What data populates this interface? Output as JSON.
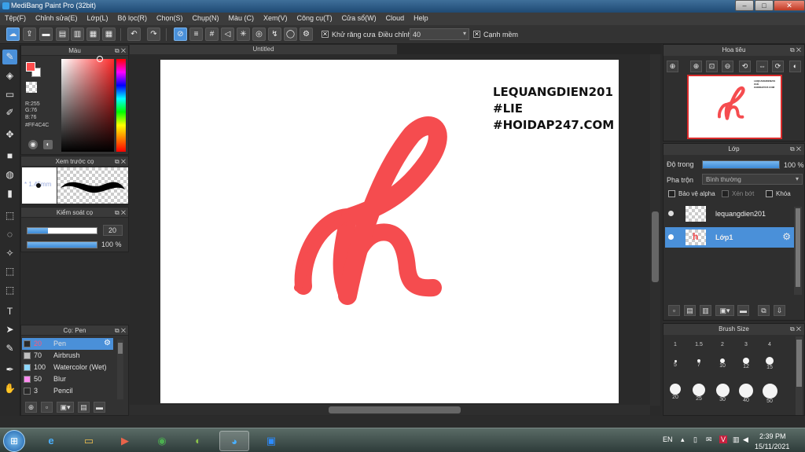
{
  "window": {
    "title": "MediBang Paint Pro (32bit)",
    "minimize": "–",
    "maximize": "□",
    "close": "✕"
  },
  "menu": [
    "Tệp(F)",
    "Chỉnh sửa(E)",
    "Lớp(L)",
    "Bộ lọc(R)",
    "Chọn(S)",
    "Chụp(N)",
    "Màu (C)",
    "Xem(V)",
    "Công cụ(T)",
    "Cửa sổ(W)",
    "Cloud",
    "Help"
  ],
  "toolbar": {
    "antialias_label": "Khử răng cưa",
    "antialias_checked": "✕",
    "adjust_label": "Điều chỉnh",
    "adjust_value": "40",
    "sharp_label": "Cạnh mềm",
    "sharp_checked": "✕"
  },
  "color_panel": {
    "title": "Màu",
    "r": "R:255",
    "g": "G:76",
    "b": "B:76",
    "hex": "#FF4C4C",
    "fg_color": "#ff4c4c"
  },
  "brush_preview": {
    "title": "Xem trước cọ",
    "size": "* 1.45mm"
  },
  "brush_control": {
    "title": "Kiểm soát cọ",
    "size_value": "20",
    "opacity_value": "100 %",
    "size_fraction": 0.29,
    "opacity_fraction": 1.0
  },
  "brush_list": {
    "title": "Cọ: Pen",
    "items": [
      {
        "num": "20",
        "name": "Pen",
        "color": "#2a2a2a",
        "selected": true
      },
      {
        "num": "70",
        "name": "Airbrush",
        "color": "#c0c0c0",
        "selected": false
      },
      {
        "num": "100",
        "name": "Watercolor (Wet)",
        "color": "#8fd8ff",
        "selected": false
      },
      {
        "num": "50",
        "name": "Blur",
        "color": "#ff8cf0",
        "selected": false
      },
      {
        "num": "3",
        "name": "Pencil",
        "color": "#2a2a2a",
        "selected": false
      }
    ]
  },
  "canvas": {
    "tab": "Untitled",
    "watermark": "LEQUANGDIEN201\n#LIE\n#HOIDAP247.COM",
    "stroke_color": "#f54c4f"
  },
  "navigator": {
    "title": "Hoa tiêu",
    "thumb_text": "LEQUANGDIEN201\n#LIE\n#HOIDAP247.COM"
  },
  "layers": {
    "title": "Lớp",
    "opacity_label": "Độ trong",
    "opacity_value": "100 %",
    "blend_label": "Pha trộn",
    "blend_value": "Bình thường",
    "protect_alpha": "Bảo vệ alpha",
    "clipping": "Xén bớt",
    "lock": "Khóa",
    "items": [
      {
        "name": "lequangdien201",
        "selected": false
      },
      {
        "name": "Lớp1",
        "selected": true
      }
    ]
  },
  "brush_size": {
    "title": "Brush Size",
    "rows": [
      [
        "1",
        "1.5",
        "2",
        "3",
        "4"
      ],
      [
        "5",
        "7",
        "10",
        "12",
        "15"
      ],
      [
        "20",
        "25",
        "30",
        "40",
        "50"
      ]
    ]
  },
  "taskbar": {
    "lang": "EN",
    "time": "2:39 PM",
    "date": "15/11/2021"
  }
}
